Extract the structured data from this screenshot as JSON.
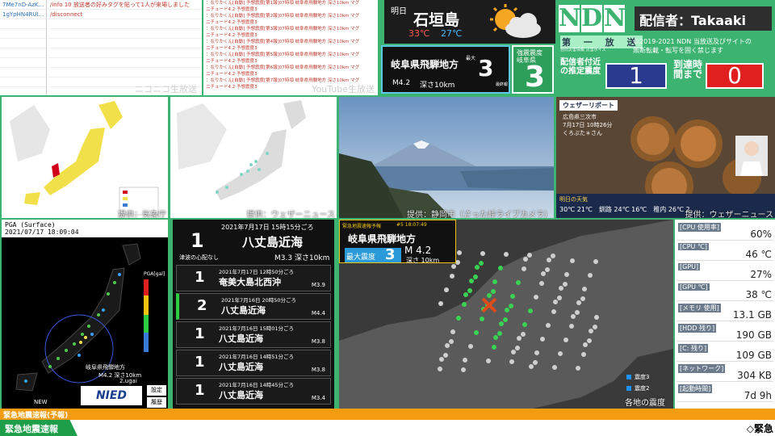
{
  "chat_left": {
    "ids": [
      "7Me7nD-AzK...",
      "1gYpHN4RUI...",
      "",
      "",
      "",
      "",
      "",
      "",
      ""
    ],
    "messages": [
      "/info 10 放送者の好みタグを貼って1人が来場しました",
      "/disconnect",
      "",
      "",
      "",
      "",
      "",
      "",
      ""
    ],
    "caption": "ニコニコ生放送"
  },
  "chat_mid": {
    "rows": [
      "：なりかくん[自動] 予想震度[第1報]07時頃 岐阜県飛騨地方 深さ10km マグ",
      "ニチュード4.2 予想震度3",
      "：なりかくん[自動] 予想震度[第2報]07時頃 岐阜県飛騨地方 深さ10km マグ",
      "ニチュード4.2 予想震度3",
      "：なりかくん[自動] 予想震度[第3報]07時頃 岐阜県飛騨地方 深さ10km マグ",
      "ニチュード4.2 予想震度3",
      "：なりかくん[自動] 予想震度[第4報]07時頃 岐阜県飛騨地方 深さ10km マグ",
      "ニチュード4.2 予想震度3",
      "：なりかくん[自動] 予想震度[第5報]07時頃 岐阜県飛騨地方 深さ10km マグ",
      "ニチュード4.2 予想震度3",
      "：なりかくん[自動] 予想震度[第6報]07時頃 岐阜県飛騨地方 深さ10km マグ",
      "ニチュード4.2 予想震度3",
      "：なりかくん[自動] 予想震度[第7報]07時頃 岐阜県飛騨地方 深さ10km マグ",
      "ニチュード4.2 予想震度3"
    ],
    "caption": "YouTube生放送"
  },
  "weather": {
    "tag": "明日",
    "city": "石垣島",
    "high": "33℃",
    "low": "27℃",
    "icon": "sun-cloud-icon"
  },
  "quake": {
    "place": "岐阜県飛騨地方",
    "max_label": "最大",
    "intensity": "3",
    "magnitude": "M4.2",
    "depth": "深さ10km",
    "last_label": "最終報"
  },
  "pref": {
    "line1": "強震震度",
    "line2": "岐阜県",
    "intensity": "3"
  },
  "brand": {
    "logo_letters": [
      "N",
      "D",
      "N"
    ],
    "subtitle": "第 一 放 送",
    "tiny": "自然災害情報 災害ボイス",
    "streamer": "配信者：Takaaki",
    "copyright1": "©2019-2021 NDN 当放送及びサイトの",
    "copyright2": "無断転載・転写を固く禁じます",
    "est_label": "配信者付近の推定震度",
    "est_value": "1",
    "arrival_label": "到達時間まで",
    "arrival_value": "0",
    "accent": "#3cb371"
  },
  "captions": {
    "map1": "提供：気象庁",
    "map2": "提供：ウェザーニュース",
    "cam": "提供：静岡市（さった峠ライブカメラ）",
    "wx": "提供：ウェザーニュース"
  },
  "weather_report": {
    "title": "ウェザーリポート",
    "location": "広島県三次市",
    "time": "7月17日 10時26分",
    "reporter": "くろぶた＊さん",
    "tomorrow": "明日の天気",
    "temps": "30℃ 21℃　釧路 24℃ 16℃　稚内 26℃ 2"
  },
  "pga": {
    "title": "PGA (Surface)",
    "time": "2021/07/17 18:09:04",
    "unit": "PGA[gal]",
    "btn1": "設定",
    "btn2": "履歴",
    "nied": "NIED",
    "new_label": "NEW",
    "epicenter": "岐阜県飛騨地方",
    "info": "M4.2 深さ10km",
    "ugai": "2.ugai"
  },
  "eq_list": {
    "first": {
      "time": "2021年7月17日 15時15分ごろ",
      "intensity": "1",
      "place": "八丈島近海",
      "tsunami": "津波の心配なし",
      "mag": "M3.3 深さ10km"
    },
    "items": [
      {
        "time": "2021年7月17日 12時50分ごろ",
        "intensity": "1",
        "place": "奄美大島北西沖",
        "mag": "M3.9"
      },
      {
        "time": "2021年7月16日 20時50分ごろ",
        "intensity": "2",
        "place": "八丈島近海",
        "mag": "M4.4"
      },
      {
        "time": "2021年7月16日 15時01分ごろ",
        "intensity": "1",
        "place": "八丈島近海",
        "mag": "M3.8"
      },
      {
        "time": "2021年7月16日 14時51分ごろ",
        "intensity": "1",
        "place": "八丈島近海",
        "mag": "M3.8"
      },
      {
        "time": "2021年7月16日 14時45分ごろ",
        "intensity": "1",
        "place": "八丈島近海",
        "mag": "M3.4"
      }
    ]
  },
  "eew": {
    "header": "緊急地震速報予報",
    "num": "#5 18:07:49",
    "place": "岐阜県飛騨地方",
    "max_label": "最大震度",
    "intensity": "3",
    "mag": "M 4.2",
    "depth": "深さ 10km",
    "legend1": "震度3",
    "legend2": "震度2",
    "legend3": "震度1",
    "caption": "各地の震度"
  },
  "stats": [
    {
      "key": "[CPU 使用率]",
      "value": "60%"
    },
    {
      "key": "[CPU ℃]",
      "value": "46 ℃"
    },
    {
      "key": "[GPU]",
      "value": "27%"
    },
    {
      "key": "[GPU ℃]",
      "value": "38 ℃"
    },
    {
      "key": "[メモリ 使用]",
      "value": "13.1 GB"
    },
    {
      "key": "[HDD 残り]",
      "value": "190 GB"
    },
    {
      "key": "[C: 残り]",
      "value": "109 GB"
    },
    {
      "key": "[ネットワーク]",
      "value": "304 KB"
    },
    {
      "key": "[起動時間]",
      "value": "7d 9h"
    }
  ],
  "ticker": {
    "top": "緊急地震速報(予報)",
    "label": "緊急地震速報",
    "announce": "◇緊急"
  }
}
